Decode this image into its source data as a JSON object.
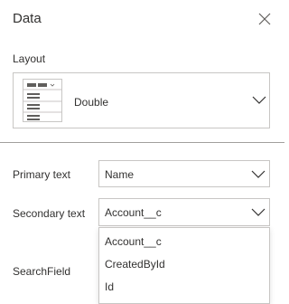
{
  "panel": {
    "title": "Data",
    "close_icon": "close-icon"
  },
  "layout": {
    "label": "Layout",
    "value": "Double",
    "thumbnail_icon": "layout-double-icon"
  },
  "fields": {
    "primary_text": {
      "label": "Primary text",
      "value": "Name"
    },
    "secondary_text": {
      "label": "Secondary text",
      "value": "Account__c"
    },
    "search_field": {
      "label": "SearchField"
    }
  },
  "dropdown_options": [
    "Account__c",
    "CreatedById",
    "Id"
  ],
  "colors": {
    "border": "#c8c6c4",
    "text": "#323130",
    "divider": "#a19f9d"
  }
}
